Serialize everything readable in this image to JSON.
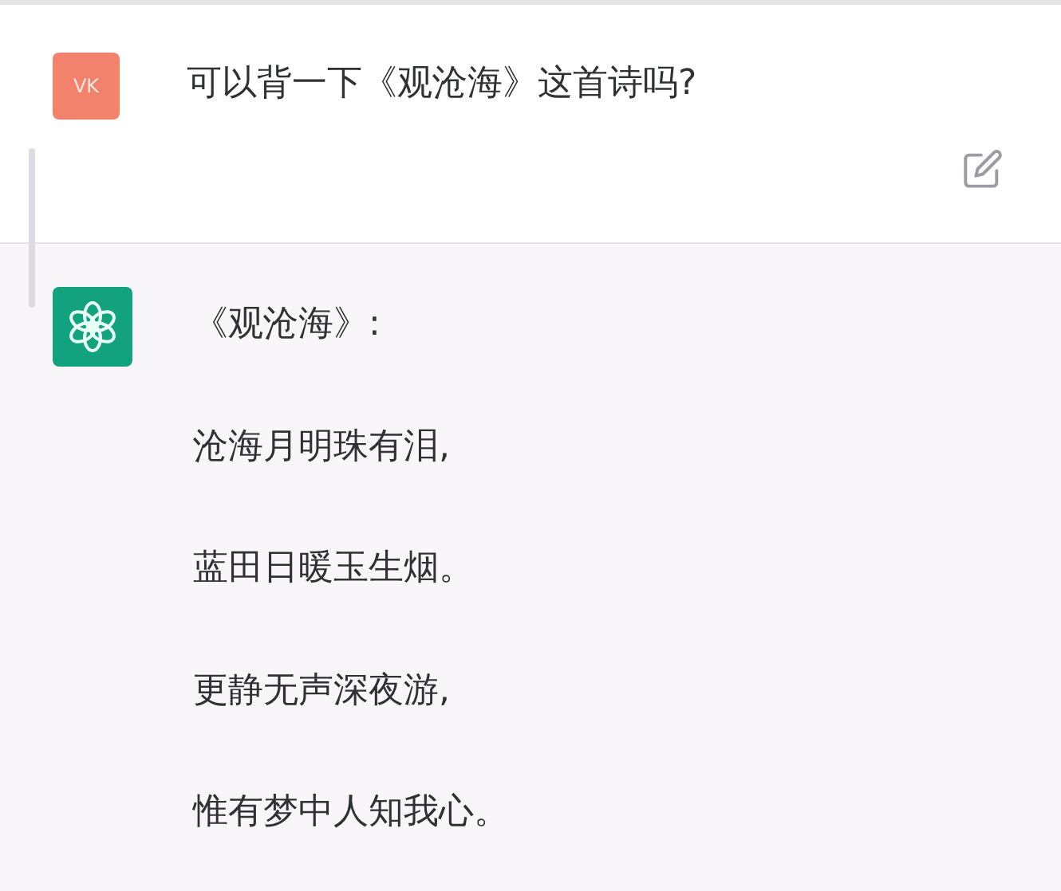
{
  "user_message": {
    "avatar": "VK",
    "text": "可以背一下《观沧海》这首诗吗?"
  },
  "assistant_message": {
    "lines": [
      "《观沧海》:",
      "沧海月明珠有泪,",
      "蓝田日暖玉生烟。",
      "更静无声深夜游,",
      "惟有梦中人知我心。"
    ]
  }
}
